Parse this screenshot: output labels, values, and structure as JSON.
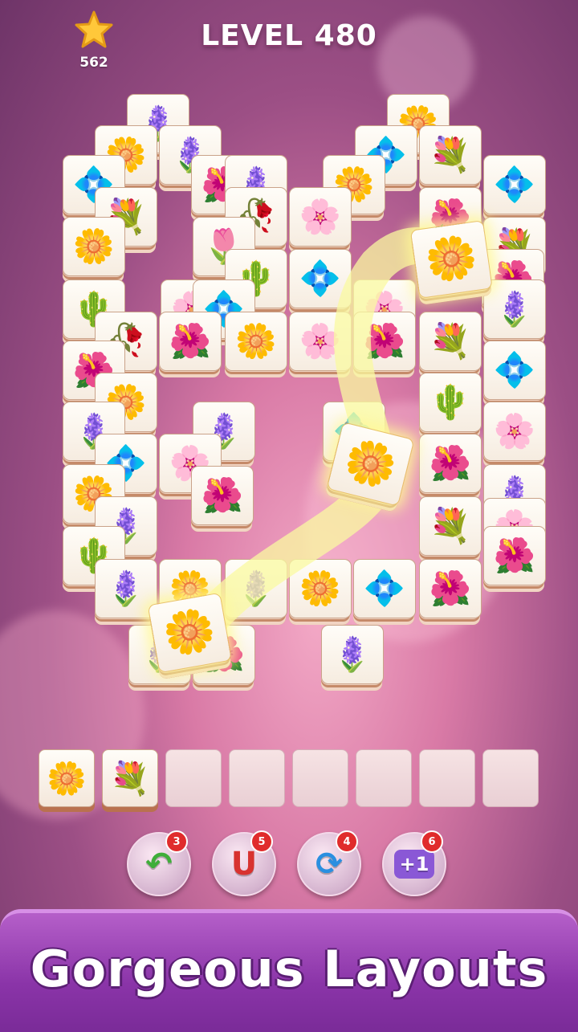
{
  "hud": {
    "stars": "562",
    "level_title": "LEVEL 480",
    "star_icon": "star-icon"
  },
  "board": {
    "tiles": [
      {
        "flower": "🪻"
      },
      {
        "flower": "🌼"
      },
      {
        "flower": "🌼"
      },
      {
        "flower": "🪻"
      },
      {
        "flower": "💠"
      },
      {
        "flower": "💐"
      },
      {
        "flower": "💠"
      },
      {
        "flower": "🌺"
      },
      {
        "flower": "🌼"
      },
      {
        "flower": "💠"
      },
      {
        "flower": "🪻"
      },
      {
        "flower": "💐"
      },
      {
        "flower": "🥀"
      },
      {
        "flower": "🌸"
      },
      {
        "flower": "🌺"
      },
      {
        "flower": "🌷"
      },
      {
        "flower": "🌼"
      },
      {
        "flower": "💐"
      },
      {
        "flower": "🌵"
      },
      {
        "flower": "💠"
      },
      {
        "flower": "🌺"
      },
      {
        "flower": "🌵"
      },
      {
        "flower": "🌸"
      },
      {
        "flower": "💠"
      },
      {
        "flower": "🌸"
      },
      {
        "flower": "🪻"
      },
      {
        "flower": "🌺"
      },
      {
        "flower": "🥀"
      },
      {
        "flower": "🌺"
      },
      {
        "flower": "🌼"
      },
      {
        "flower": "🌸"
      },
      {
        "flower": "🌺"
      },
      {
        "flower": "💐"
      },
      {
        "flower": "💠"
      },
      {
        "flower": "🌺"
      },
      {
        "flower": "🌼"
      },
      {
        "flower": "🪻"
      },
      {
        "flower": "🌵"
      },
      {
        "flower": "🌸"
      },
      {
        "flower": "🪻"
      },
      {
        "flower": "💠"
      },
      {
        "flower": "🌸"
      },
      {
        "flower": "💠"
      },
      {
        "flower": "💐"
      },
      {
        "flower": "🌺"
      },
      {
        "flower": "🪻"
      },
      {
        "flower": "🌼"
      },
      {
        "flower": "🌺"
      },
      {
        "flower": "🌸"
      },
      {
        "flower": "🌵"
      },
      {
        "flower": "🪻"
      },
      {
        "flower": "💐"
      },
      {
        "flower": "🌺"
      },
      {
        "flower": "🪻"
      },
      {
        "flower": "🌼"
      },
      {
        "flower": "🪻"
      },
      {
        "flower": "🌼"
      },
      {
        "flower": "💠"
      },
      {
        "flower": "🌺"
      },
      {
        "flower": "🪻"
      },
      {
        "flower": "🌺"
      },
      {
        "flower": "🪻"
      }
    ],
    "lifted_tiles": [
      {
        "flower": "🌼"
      },
      {
        "flower": "🌼"
      },
      {
        "flower": "🌼"
      }
    ]
  },
  "tray": {
    "slots": [
      "🌼",
      "💐",
      "",
      "",
      "",
      "",
      "",
      ""
    ]
  },
  "boosters": [
    {
      "name": "undo",
      "icon": "undo-arrow-icon",
      "glyph": "↶",
      "count": "3",
      "color": "#3fae3a"
    },
    {
      "name": "magnet",
      "icon": "magnet-icon",
      "glyph": "U",
      "count": "5",
      "color": "#d8322f"
    },
    {
      "name": "shuffle",
      "icon": "shuffle-icon",
      "glyph": "⟳",
      "count": "4",
      "color": "#2a8fe0"
    },
    {
      "name": "extra-slot",
      "icon": "plus-one-icon",
      "glyph": "+1",
      "count": "6",
      "color": "#8a58d6"
    }
  ],
  "banner": {
    "text": "Gorgeous Layouts"
  }
}
